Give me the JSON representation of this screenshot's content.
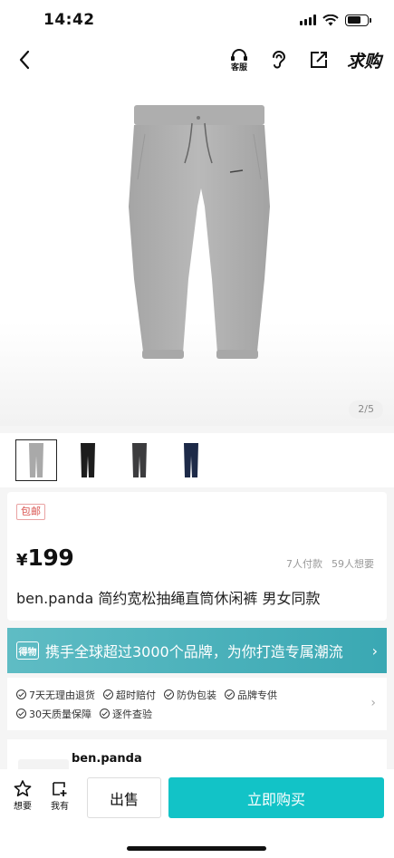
{
  "status_bar": {
    "time": "14:42"
  },
  "nav": {
    "want_label": "求购",
    "service_label": "客服"
  },
  "gallery": {
    "page_indicator": "2/5"
  },
  "thumbnails": [
    {
      "color": "#a9a9a9"
    },
    {
      "color": "#1d1d1d"
    },
    {
      "color": "#3c3c3e"
    },
    {
      "color": "#1d2a48"
    }
  ],
  "product": {
    "free_shipping_tag": "包邮",
    "price_symbol": "¥",
    "price": "199",
    "paid_count": "7人付款",
    "want_count": "59人想要",
    "title": "ben.panda 简约宽松抽绳直筒休闲裤 男女同款"
  },
  "banner": {
    "badge": "得物",
    "text": "携手全球超过3000个品牌，为你打造专属潮流"
  },
  "guarantees": {
    "row1": [
      "7天无理由退货",
      "超时赔付",
      "防伪包装",
      "品牌专供"
    ],
    "row2": [
      "30天质量保障",
      "逐件查验"
    ]
  },
  "seller": {
    "name": "ben.panda"
  },
  "bottom_bar": {
    "want_label": "想要",
    "have_label": "我有",
    "sell_label": "出售",
    "buy_label": "立即购买"
  },
  "colors": {
    "accent": "#12c3c7",
    "banner": "#4cb3bc"
  }
}
